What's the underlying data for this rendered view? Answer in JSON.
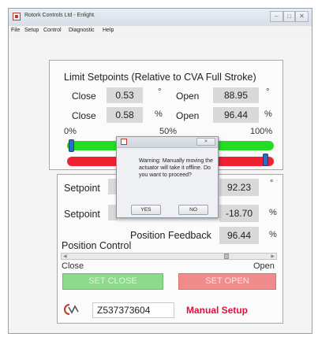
{
  "window": {
    "title": "Rotork Controls Ltd - Enlight.",
    "buttons": {
      "minimize": "–",
      "maximize": "□",
      "close": "✕"
    }
  },
  "menu": [
    "File",
    "Setup",
    "Control",
    "Diagnostic",
    "Help"
  ],
  "limits": {
    "heading": "Limit Setpoints (Relative to CVA Full Stroke)",
    "row1": {
      "close_label": "Close",
      "close_value": "0.53",
      "close_unit": "°",
      "open_label": "Open",
      "open_value": "88.95",
      "open_unit": "°"
    },
    "row2": {
      "close_label": "Close",
      "close_value": "0.58",
      "close_unit": "%",
      "open_label": "Open",
      "open_value": "96.44",
      "open_unit": "%"
    },
    "scale": {
      "min": "0%",
      "mid": "50%",
      "max": "100%"
    },
    "green_handle_position": 0.02,
    "red_handle_position": 0.96,
    "colors": {
      "green_bar": "#22dd22",
      "red_bar": "#ee2233",
      "handle": "#2d6bc9"
    }
  },
  "setpoints": {
    "row1": {
      "label": "Setpoint",
      "value": "92.23",
      "unit": "°"
    },
    "row2": {
      "label": "Setpoint",
      "value": "-18.70",
      "unit": "%"
    },
    "feedback": {
      "label": "Position Feedback",
      "value": "96.44",
      "unit": "%"
    },
    "position_control": {
      "heading": "Position Control",
      "close_label": "Close",
      "open_label": "Open",
      "slider_value": 0.79
    },
    "buttons": {
      "set_close": "SET CLOSE",
      "set_open": "SET OPEN"
    }
  },
  "footer": {
    "serial": "Z537373604",
    "mode": "Manual Setup",
    "mode_color": "#e0103c"
  },
  "dialog": {
    "message": "Warning: Manually moving the actuator will take it offline. Do you want to proceed?",
    "yes": "YES",
    "no": "NO",
    "close_glyph": "✕"
  }
}
